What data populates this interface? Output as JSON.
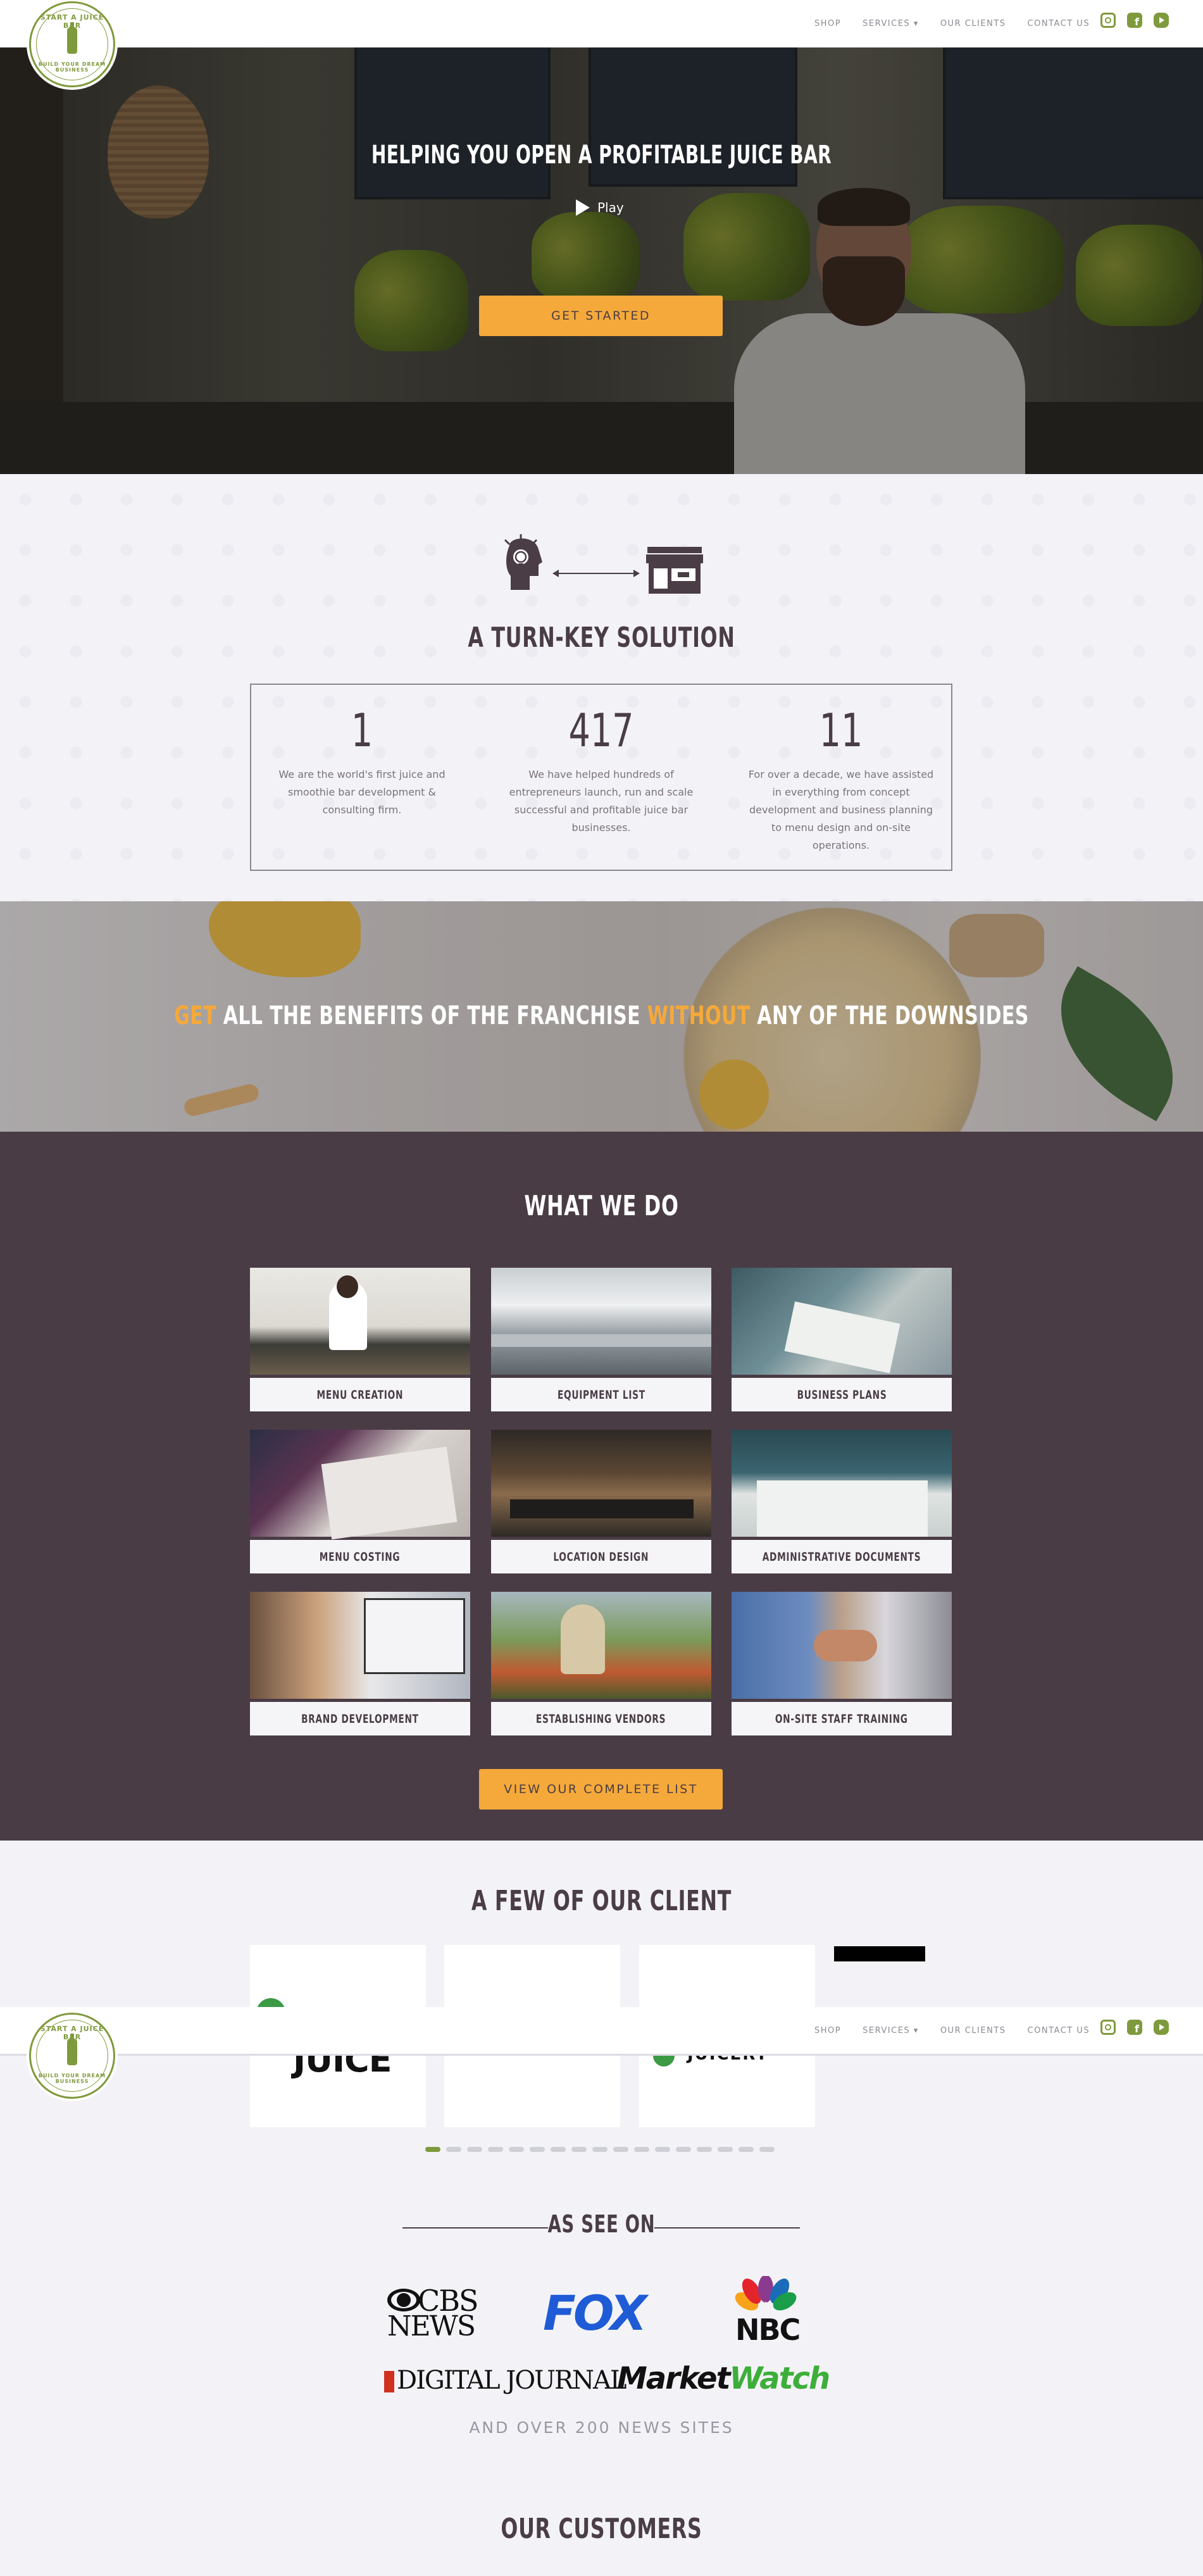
{
  "header": {
    "logo_top": "START A JUICE BAR",
    "logo_bottom": "BUILD YOUR DREAM BUSINESS",
    "nav": [
      "SHOP",
      "SERVICES ▾",
      "OUR CLIENTS",
      "CONTACT US"
    ],
    "social_icons": [
      "instagram-icon",
      "facebook-icon",
      "youtube-icon"
    ],
    "accent": "#7f9a3c"
  },
  "hero": {
    "title": "HELPING YOU OPEN A PROFITABLE JUICE BAR",
    "play_label": "Play",
    "cta": "GET STARTED",
    "cta_color": "#f5a93a"
  },
  "turnkey": {
    "title": "A TURN-KEY SOLUTION",
    "stats": [
      {
        "num": "1",
        "desc": "We are the world's first juice and smoothie bar development & consulting firm."
      },
      {
        "num": "417",
        "desc": "We have helped hundreds of entrepreneurs launch, run and scale successful and profitable juice bar businesses."
      },
      {
        "num": "11",
        "desc": "For over a decade, we have assisted in everything from concept development and business planning to menu design and on-site operations."
      }
    ]
  },
  "banner": {
    "w1": "GET",
    "w2": " ALL THE BENEFITS OF THE FRANCHISE ",
    "w3": "WITHOUT",
    "w4": " ANY OF THE DOWNSIDES"
  },
  "whatwedo": {
    "title": "WHAT WE DO",
    "items": [
      "MENU CREATION",
      "EQUIPMENT LIST",
      "BUSINESS PLANS",
      "MENU COSTING",
      "LOCATION DESIGN",
      "ADMINISTRATIVE DOCUMENTS",
      "BRAND DEVELOPMENT",
      "ESTABLISHING VENDORS",
      "ON-SITE STAFF TRAINING"
    ],
    "cta": "VIEW OUR COMPLETE LIST",
    "bg": "#4a3c45"
  },
  "clients": {
    "title": "A FEW OF OUR CLIENT",
    "logo_text_1": "JUICE",
    "logo_text_3": "JUICERY",
    "pagination_total": 17,
    "pagination_active": 1
  },
  "asseen": {
    "title": "AS SEE ON",
    "outlets": [
      "CBS NEWS",
      "FOX",
      "NBC",
      "DIGITAL JOURNAL",
      "MarketWatch"
    ],
    "cbs_line1": "CBS",
    "cbs_line2": "NEWS",
    "dj_1": "DIGITAL",
    "dj_2": " JOURNAL",
    "mw_1": "Market",
    "mw_2": "Watch",
    "more": "AND OVER 200 NEWS SITES"
  },
  "customers": {
    "title": "OUR CUSTOMERS"
  }
}
